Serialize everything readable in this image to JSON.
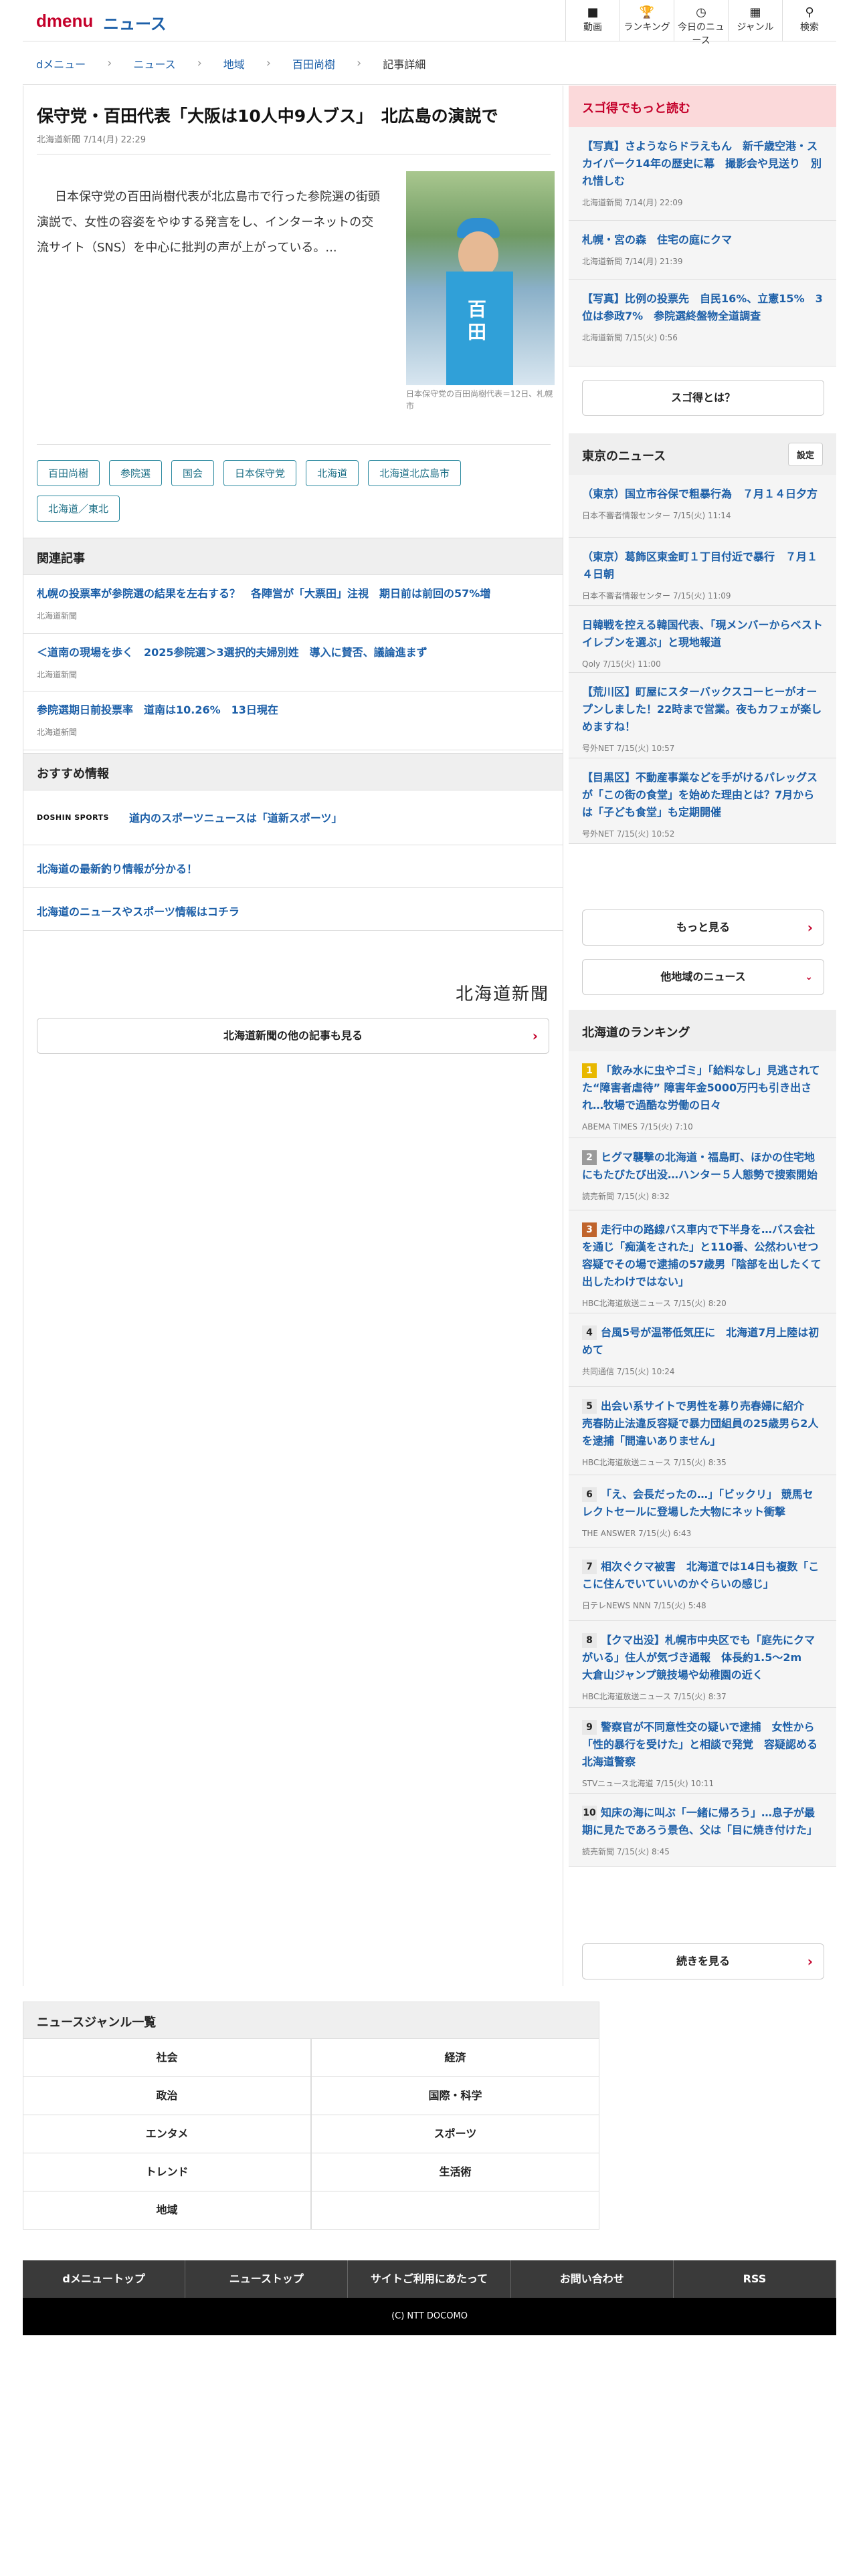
{
  "header": {
    "logo": "dmenu",
    "site_name": "ニュース",
    "nav": [
      {
        "icon": "video-icon",
        "glyph": "■",
        "label": "動画"
      },
      {
        "icon": "trophy-icon",
        "glyph": "🏆",
        "label": "ランキング"
      },
      {
        "icon": "clock-icon",
        "glyph": "◷",
        "label": "今日のニュース"
      },
      {
        "icon": "grid-icon",
        "glyph": "▦",
        "label": "ジャンル"
      },
      {
        "icon": "search-icon",
        "glyph": "⚲",
        "label": "検索"
      }
    ]
  },
  "breadcrumb": [
    "dメニュー",
    "ニュース",
    "地域",
    "百田尚樹",
    "記事詳細"
  ],
  "article": {
    "title": "保守党・百田代表「大阪は10人中9人ブス」　北広島の演説で",
    "meta": "北海道新聞 7/14(月) 22:29",
    "lead": "日本保守党の百田尚樹代表が北広島市で行った参院選の街頭演説で、女性の容姿をやゆする発言をし、インターネットの交流サイト（SNS）を中心に批判の声が上がっている。...",
    "photo_text": "百田",
    "caption": "日本保守党の百田尚樹代表＝12日、札幌市",
    "tags": [
      "百田尚樹",
      "参院選",
      "国会",
      "日本保守党",
      "北海道",
      "北海道北広島市",
      "北海道／東北"
    ]
  },
  "related": {
    "heading": "関連記事",
    "items": [
      {
        "title": "札幌の投票率が参院選の結果を左右する？　各陣営が「大票田」注視　期日前は前回の57%増",
        "source": "北海道新聞"
      },
      {
        "title": "＜道南の現場を歩く　2025参院選＞3選択的夫婦別姓　導入に賛否、議論進まず",
        "source": "北海道新聞"
      },
      {
        "title": "参院選期日前投票率　道南は10.26%　13日現在",
        "source": "北海道新聞"
      }
    ]
  },
  "recommended": {
    "heading": "おすすめ情報",
    "logo_text": "DOSHIN SPORTS",
    "items": [
      "道内のスポーツニュースは「道新スポーツ」",
      "北海道の最新釣り情報が分かる！",
      "北海道のニュースやスポーツ情報はコチラ"
    ]
  },
  "publisher": {
    "logo": "北海道新聞",
    "more_button": "北海道新聞の他の記事も見る"
  },
  "sidebar": {
    "sugotoku": {
      "heading": "スゴ得でもっと読む",
      "items": [
        {
          "title": "【写真】さようならドラえもん　新千歳空港・スカイパーク14年の歴史に幕　撮影会や見送り　別れ惜しむ",
          "source": "北海道新聞 7/14(月) 22:09"
        },
        {
          "title": "札幌・宮の森　住宅の庭にクマ",
          "source": "北海道新聞 7/14(月) 21:39"
        },
        {
          "title": "【写真】比例の投票先　自民16%、立憲15%　3位は参政7%　参院選終盤物全道調査",
          "source": "北海道新聞 7/15(火) 0:56"
        }
      ],
      "button": "スゴ得とは？"
    },
    "tokyo": {
      "heading": "東京のニュース",
      "settings": "設定",
      "items": [
        {
          "title": "（東京）国立市谷保で粗暴行為　７月１４日夕方",
          "source": "日本不審者情報センター 7/15(火) 11:14"
        },
        {
          "title": "（東京）葛飾区東金町１丁目付近で暴行　７月１４日朝",
          "source": "日本不審者情報センター 7/15(火) 11:09"
        },
        {
          "title": "日韓戦を控える韓国代表、「現メンバーからベストイレブンを選ぶ」と現地報道",
          "source": "Qoly 7/15(火) 11:00"
        },
        {
          "title": "【荒川区】町屋にスターバックスコーヒーがオープンしました！22時まで営業。夜もカフェが楽しめますね！",
          "source": "号外NET 7/15(火) 10:57"
        },
        {
          "title": "【目黒区】不動産事業などを手がけるパレッグスが「この街の食堂」を始めた理由とは？7月からは「子ども食堂」も定期開催",
          "source": "号外NET 7/15(火) 10:52"
        }
      ],
      "more_button": "もっと見る",
      "other_button": "他地域のニュース"
    },
    "ranking": {
      "heading": "北海道のランキング",
      "items": [
        {
          "no": "1",
          "title": "「飲み水に虫やゴミ」「給料なし」見逃されてた“障害者虐待” 障害年金5000万円も引き出され…牧場で過酷な労働の日々",
          "source": "ABEMA TIMES 7/15(火) 7:10"
        },
        {
          "no": "2",
          "title": "ヒグマ襲撃の北海道・福島町、ほかの住宅地にもたびたび出没…ハンター５人態勢で捜索開始",
          "source": "読売新聞 7/15(火) 8:32"
        },
        {
          "no": "3",
          "title": "走行中の路線バス車内で下半身を…バス会社を通じ「痴漢をされた」と110番、公然わいせつ容疑でその場で逮捕の57歳男「陰部を出したくて出したわけではない」",
          "source": "HBC北海道放送ニュース 7/15(火) 8:20"
        },
        {
          "no": "4",
          "title": "台風5号が温帯低気圧に　北海道7月上陸は初めて",
          "source": "共同通信 7/15(火) 10:24"
        },
        {
          "no": "5",
          "title": "出会い系サイトで男性を募り売春婦に紹介　売春防止法違反容疑で暴力団組員の25歳男ら2人を逮捕「間違いありません」",
          "source": "HBC北海道放送ニュース 7/15(火) 8:35"
        },
        {
          "no": "6",
          "title": "「え、会長だったの…」「ビックリ」 競馬セレクトセールに登場した大物にネット衝撃",
          "source": "THE ANSWER 7/15(火) 6:43"
        },
        {
          "no": "7",
          "title": "相次ぐクマ被害　北海道では14日も複数「ここに住んでいていいのかぐらいの感じ」",
          "source": "日テレNEWS NNN 7/15(火) 5:48"
        },
        {
          "no": "8",
          "title": "【クマ出没】札幌市中央区でも「庭先にクマがいる」住人が気づき通報　体長約1.5～2m　大倉山ジャンプ競技場や幼稚園の近く",
          "source": "HBC北海道放送ニュース 7/15(火) 8:37"
        },
        {
          "no": "9",
          "title": "警察官が不同意性交の疑いで逮捕　女性から「性的暴行を受けた」と相談で発覚　容疑認める　北海道警察",
          "source": "STVニュース北海道 7/15(火) 10:11"
        },
        {
          "no": "10",
          "title": "知床の海に叫ぶ「一緒に帰ろう」…息子が最期に見たであろう景色、父は「目に焼き付けた」",
          "source": "読売新聞 7/15(火) 8:45"
        }
      ],
      "more_button": "続きを見る"
    }
  },
  "genre": {
    "heading": "ニュースジャンル一覧",
    "items": [
      "社会",
      "経済",
      "政治",
      "国際・科学",
      "エンタメ",
      "スポーツ",
      "トレンド",
      "生活術",
      "地域",
      ""
    ]
  },
  "footer": {
    "links": [
      "dメニュートップ",
      "ニューストップ",
      "サイトご利用にあたって",
      "お問い合わせ",
      "RSS"
    ],
    "copyright": "(C) NTT DOCOMO"
  }
}
